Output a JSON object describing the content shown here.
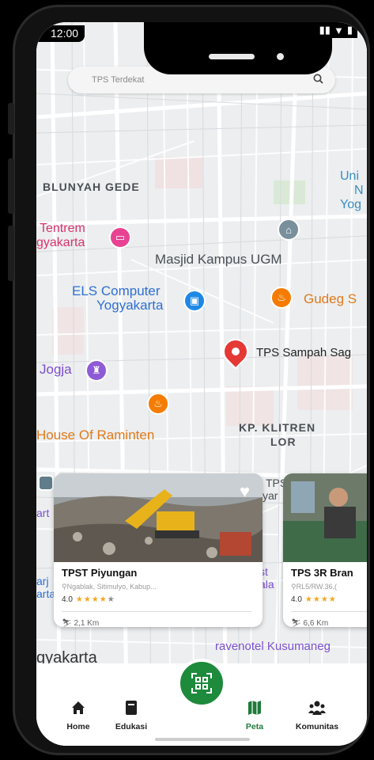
{
  "status": {
    "time": "12:00"
  },
  "search": {
    "placeholder": "TPS Terdekat",
    "icon": "search-icon"
  },
  "map_labels": [
    "BLUNYAH GEDE",
    "Tentrem",
    "gyakarta",
    "Masjid Kampus UGM",
    "ELS Computer",
    "Yogyakarta",
    "Gudeg S",
    "TPS Sampah Sag",
    "Jogja",
    "House Of Raminten",
    "KP. KLITREN",
    "LOR",
    "Uni",
    "N",
    "Yog",
    "gyakarta",
    "TPS",
    "yar",
    "st",
    "ala",
    "art",
    "arj",
    "arta",
    "ravenotel Kusumaneg"
  ],
  "cards": [
    {
      "title": "TPST Piyungan",
      "address": "Ngablak, Sitimulyo, Kabup...",
      "rating": "4.0",
      "distance": "2,1 Km"
    },
    {
      "title": "TPS 3R Bran",
      "address": "RL5/RW.36,(",
      "rating": "4.0",
      "distance": "6,6 Km"
    }
  ],
  "nav": {
    "home": "Home",
    "edukasi": "Edukasi",
    "peta": "Peta",
    "komunitas": "Komunitas"
  },
  "colors": {
    "accent": "#1d8a3c",
    "star": "#f5a623",
    "pin_red": "#e53935",
    "pin_pink": "#e84393",
    "pin_blue": "#1e88e5",
    "pin_orange": "#f57c00",
    "pin_purple": "#8e5bd6",
    "pin_gray": "#78909c"
  }
}
